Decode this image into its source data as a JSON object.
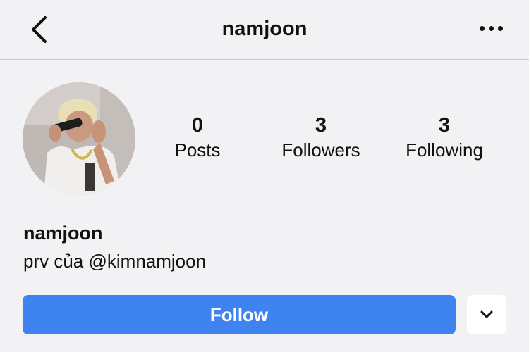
{
  "header": {
    "title": "namjoon",
    "back_icon": "chevron-left-icon",
    "more_icon": "more-horizontal-icon"
  },
  "profile": {
    "avatar": "profile-photo",
    "name": "namjoon",
    "bio": "prv của @kimnamjoon"
  },
  "stats": [
    {
      "value": "0",
      "label": "Posts"
    },
    {
      "value": "3",
      "label": "Followers"
    },
    {
      "value": "3",
      "label": "Following"
    }
  ],
  "actions": {
    "follow_label": "Follow",
    "dropdown_icon": "chevron-down-icon"
  },
  "colors": {
    "accent": "#3f83f0",
    "background": "#f2f2f4",
    "text": "#111111"
  }
}
